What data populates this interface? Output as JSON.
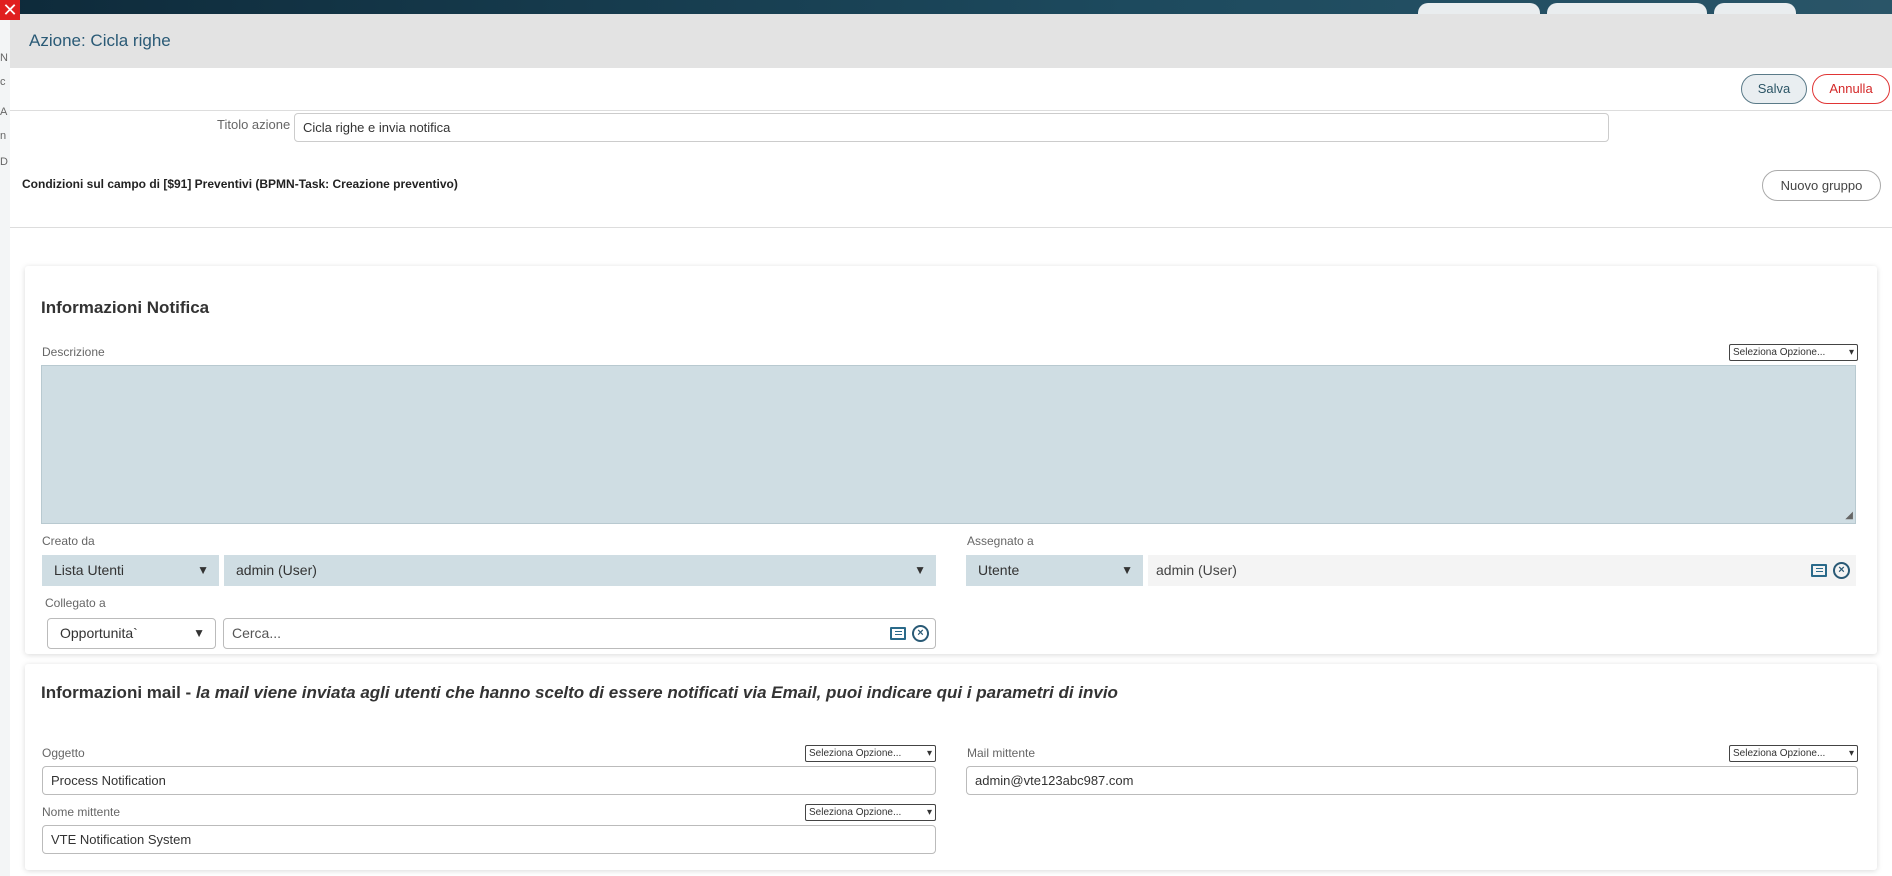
{
  "modal": {
    "title": "Azione: Cicla righe",
    "save_label": "Salva",
    "cancel_label": "Annulla"
  },
  "action": {
    "title_label": "Titolo azione",
    "title_value": "Cicla righe e invia notifica",
    "conditions_label": "Condizioni sul campo di [$91] Preventivi (BPMN-Task: Creazione preventivo)",
    "new_group_label": "Nuovo gruppo"
  },
  "notifica": {
    "title": "Informazioni Notifica",
    "descrizione_label": "Descrizione",
    "select_option_label": "Seleziona Opzione...",
    "creato_da_label": "Creato da",
    "creato_da_type": "Lista Utenti",
    "creato_da_value": "admin (User)",
    "assegnato_a_label": "Assegnato a",
    "assegnato_a_type": "Utente",
    "assegnato_a_value": "admin (User)",
    "collegato_a_label": "Collegato a",
    "collegato_a_type": "Opportunita`",
    "collegato_a_placeholder": "Cerca..."
  },
  "mail": {
    "title_bold": "Informazioni mail - ",
    "title_italic": "la mail viene inviata agli utenti che hanno scelto di essere notificati via Email, puoi indicare qui i parametri di invio",
    "oggetto_label": "Oggetto",
    "oggetto_value": "Process Notification",
    "mittente_label": "Mail mittente",
    "mittente_value": "admin@vte123abc987.com",
    "nome_mittente_label": "Nome mittente",
    "nome_mittente_value": "VTE Notification System",
    "select_option_label": "Seleziona Opzione..."
  },
  "background": {
    "close_glyph": "✕",
    "side_letters": [
      "N",
      "c",
      "A",
      "n",
      "D"
    ]
  },
  "colors": {
    "accent": "#2a5a76",
    "field_bg": "#cfdde3",
    "danger": "#d42828"
  }
}
